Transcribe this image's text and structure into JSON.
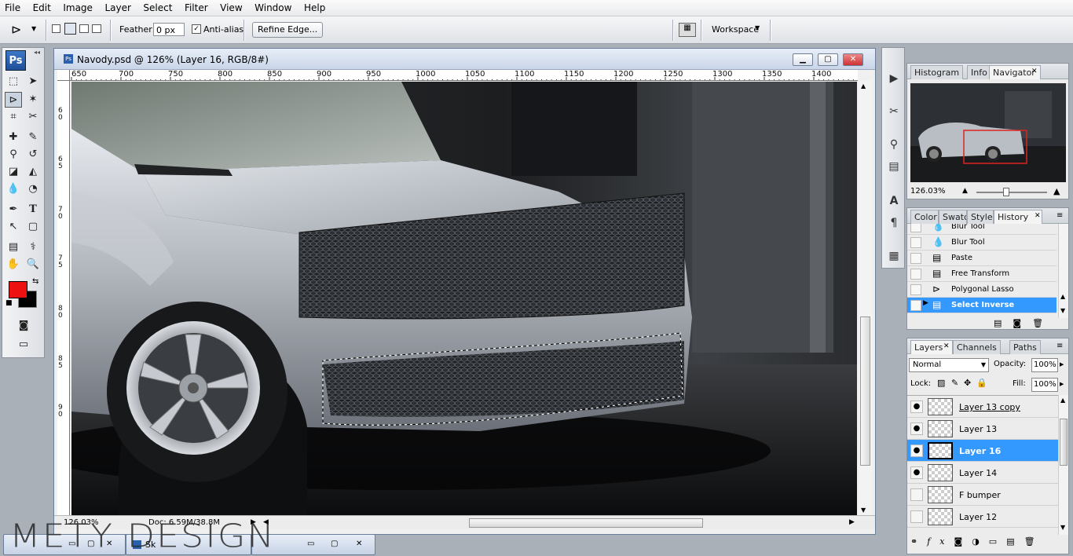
{
  "menubar": {
    "items": [
      "File",
      "Edit",
      "Image",
      "Layer",
      "Select",
      "Filter",
      "View",
      "Window",
      "Help"
    ]
  },
  "options_bar": {
    "feather_label": "Feather:",
    "feather_value": "0 px",
    "antialias_label": "Anti-alias",
    "refine_edge_label": "Refine Edge...",
    "workspace_label": "Workspace"
  },
  "toolbox": {
    "logo": "Ps",
    "foreground_color": "#ee1111",
    "background_color": "#000000"
  },
  "document": {
    "title": "Navody.psd @ 126% (Layer 16, RGB/8#)",
    "ruler_h": [
      "650",
      "700",
      "750",
      "800",
      "850",
      "900",
      "950",
      "1000",
      "1050",
      "1100",
      "1150",
      "1200",
      "1250",
      "1300",
      "1350",
      "1400"
    ],
    "ruler_v": [
      "6 0",
      "6 5",
      "7 0",
      "7 5",
      "8 0",
      "8 5",
      "9 0"
    ],
    "zoom": "126.03%",
    "doc_size": "Doc: 6.59M/38.8M"
  },
  "navigator": {
    "tabs": [
      "Histogram",
      "Info",
      "Navigator"
    ],
    "zoom": "126.03%"
  },
  "history": {
    "tabs": [
      "Color",
      "Swatc",
      "Styles",
      "History"
    ],
    "items": [
      {
        "label": "Blur Tool",
        "icon": "drop-icon"
      },
      {
        "label": "Blur Tool",
        "icon": "drop-icon"
      },
      {
        "label": "Paste",
        "icon": "doc-icon"
      },
      {
        "label": "Free Transform",
        "icon": "doc-icon"
      },
      {
        "label": "Polygonal Lasso",
        "icon": "lasso-icon"
      },
      {
        "label": "Select Inverse",
        "icon": "doc-icon"
      }
    ]
  },
  "layers": {
    "tabs": [
      "Layers",
      "Channels",
      "Paths"
    ],
    "blend_mode": "Normal",
    "opacity_label": "Opacity:",
    "opacity": "100%",
    "lock_label": "Lock:",
    "fill_label": "Fill:",
    "fill": "100%",
    "items": [
      {
        "name": "Layer 13 copy",
        "visible": true
      },
      {
        "name": "Layer 13",
        "visible": true
      },
      {
        "name": "Layer 16",
        "visible": true,
        "selected": true
      },
      {
        "name": "Layer 14",
        "visible": true
      },
      {
        "name": "F bumper",
        "visible": false
      },
      {
        "name": "Layer 12",
        "visible": false
      }
    ]
  },
  "bottom_windows": [
    "Sk"
  ],
  "watermark": "METY DESIGN",
  "colors": {
    "selection_blue": "#3399ff",
    "nav_red": "#dd2222"
  }
}
